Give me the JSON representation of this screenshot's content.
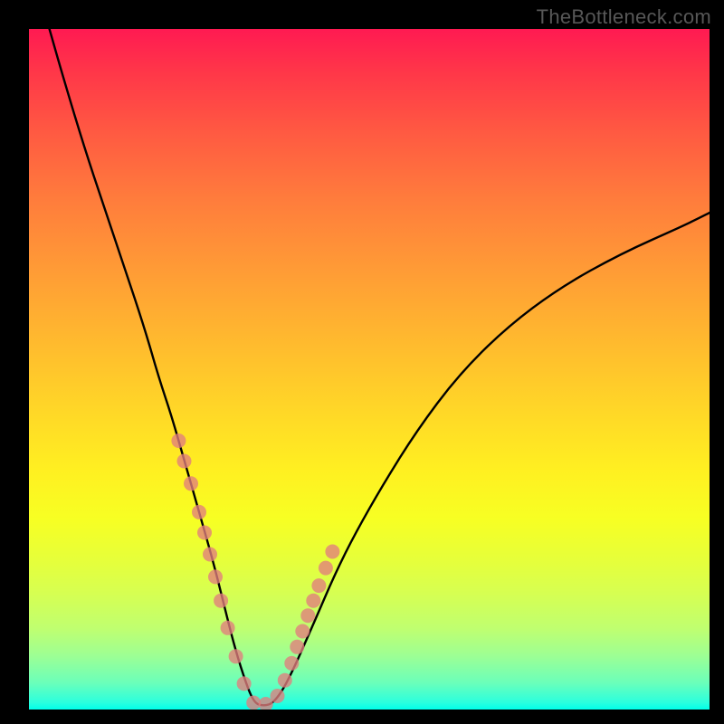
{
  "watermark": "TheBottleneck.com",
  "chart_data": {
    "type": "line",
    "title": "",
    "xlabel": "",
    "ylabel": "",
    "xlim": [
      0,
      100
    ],
    "ylim": [
      0,
      100
    ],
    "curve": {
      "name": "bottleneck-curve",
      "x": [
        3,
        5,
        8,
        11,
        14,
        17,
        19,
        21,
        23,
        25,
        27,
        28.5,
        30,
        31.5,
        33,
        34.5,
        36,
        38,
        42,
        45,
        48,
        52,
        57,
        63,
        70,
        78,
        87,
        96,
        100
      ],
      "y": [
        100,
        93,
        83,
        74,
        65,
        56,
        49,
        43,
        36,
        29,
        22,
        16,
        10,
        5,
        1,
        0.5,
        1,
        4,
        13,
        20,
        26,
        33,
        41,
        49,
        56,
        62,
        67,
        71,
        73
      ]
    },
    "points": {
      "name": "sample-dots",
      "color": "#e27d7d",
      "x": [
        22.0,
        22.8,
        23.8,
        25.0,
        25.8,
        26.6,
        27.4,
        28.2,
        29.2,
        30.4,
        31.6,
        33.0,
        34.8,
        36.5,
        37.6,
        38.6,
        39.4,
        40.2,
        41.0,
        41.8,
        42.6,
        43.6,
        44.6
      ],
      "y": [
        39.5,
        36.5,
        33.2,
        29.0,
        26.0,
        22.8,
        19.5,
        16.0,
        12.0,
        7.8,
        3.8,
        1.0,
        0.8,
        2.0,
        4.3,
        6.8,
        9.2,
        11.5,
        13.8,
        16.0,
        18.2,
        20.8,
        23.2
      ]
    }
  }
}
